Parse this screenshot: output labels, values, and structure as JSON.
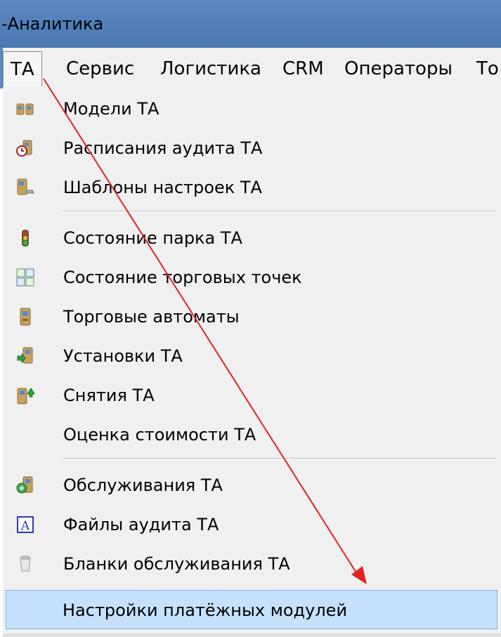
{
  "window": {
    "title": "-Аналитика"
  },
  "menubar": {
    "items": [
      {
        "label": "ТА",
        "active": true
      },
      {
        "label": "Сервис"
      },
      {
        "label": "Логистика"
      },
      {
        "label": "CRM"
      },
      {
        "label": "Операторы"
      },
      {
        "label": "То"
      }
    ]
  },
  "dropdown": {
    "items": [
      {
        "label": "Модели ТА",
        "icon": "vending-machines-pair-icon"
      },
      {
        "label": "Расписания аудита ТА",
        "icon": "audit-schedule-icon"
      },
      {
        "label": "Шаблоны настроек ТА",
        "icon": "settings-template-icon"
      },
      {
        "label": "Состояние парка ТА",
        "icon": "traffic-light-icon"
      },
      {
        "label": "Состояние торговых точек",
        "icon": "grid-status-icon"
      },
      {
        "label": "Торговые автоматы",
        "icon": "vending-machine-icon"
      },
      {
        "label": "Установки ТА",
        "icon": "install-arrow-icon"
      },
      {
        "label": "Снятия ТА",
        "icon": "remove-arrow-icon"
      },
      {
        "label": "Оценка стоимости ТА",
        "icon": ""
      },
      {
        "label": "Обслуживания ТА",
        "icon": "service-icon"
      },
      {
        "label": "Файлы аудита ТА",
        "icon": "font-file-icon"
      },
      {
        "label": "Бланки обслуживания ТА",
        "icon": "blank-form-icon"
      },
      {
        "label": "Настройки платёжных модулей",
        "icon": "",
        "highlighted": true
      }
    ]
  },
  "annotation": {
    "type": "arrow",
    "color": "#e02424"
  }
}
